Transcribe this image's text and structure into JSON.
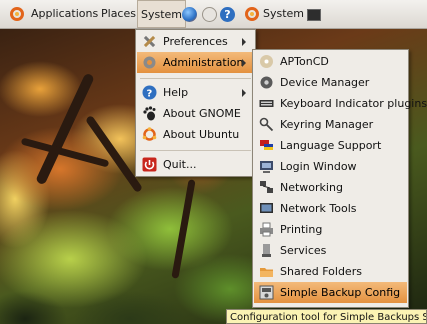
{
  "panel": {
    "applications_label": "Applications",
    "places_label": "Places",
    "system_label": "System",
    "system2_label": "System"
  },
  "system_menu": {
    "items": [
      {
        "label": "Preferences",
        "icon": "preferences-icon"
      },
      {
        "label": "Administration",
        "icon": "administration-icon"
      },
      {
        "label": "Help",
        "icon": "help-icon"
      },
      {
        "label": "About GNOME",
        "icon": "gnome-foot-icon"
      },
      {
        "label": "About Ubuntu",
        "icon": "ubuntu-icon"
      },
      {
        "label": "Quit...",
        "icon": "power-icon"
      }
    ]
  },
  "admin_menu": {
    "items": [
      {
        "label": "APTonCD"
      },
      {
        "label": "Device Manager"
      },
      {
        "label": "Keyboard Indicator plugins"
      },
      {
        "label": "Keyring Manager"
      },
      {
        "label": "Language Support"
      },
      {
        "label": "Login Window"
      },
      {
        "label": "Networking"
      },
      {
        "label": "Network Tools"
      },
      {
        "label": "Printing"
      },
      {
        "label": "Services"
      },
      {
        "label": "Shared Folders"
      },
      {
        "label": "Simple Backup Config"
      }
    ]
  },
  "tooltip": "Configuration tool for Simple Backups Suite",
  "colors": {
    "highlight": "#e4913f",
    "panel": "#e6e2dc",
    "menu_bg": "#efece7"
  }
}
